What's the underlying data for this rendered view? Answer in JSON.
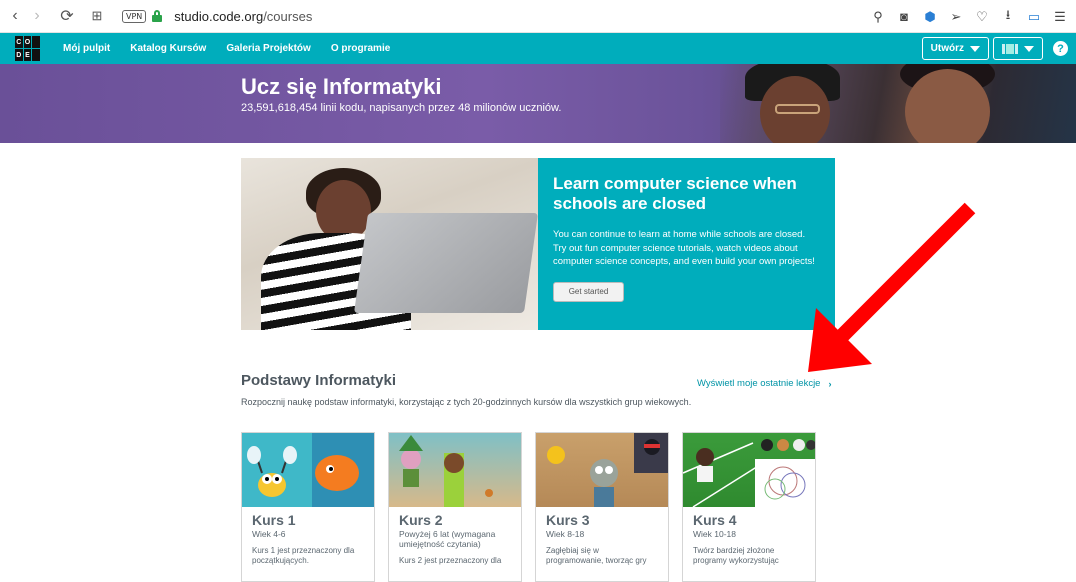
{
  "browser": {
    "vpn_label": "VPN",
    "url_domain": "studio.code.org",
    "url_path": "/courses"
  },
  "nav": {
    "logo_letters": [
      "C",
      "O",
      "D",
      "E"
    ],
    "links": [
      "Mój pulpit",
      "Katalog Kursów",
      "Galeria Projektów",
      "O programie"
    ],
    "create_label": "Utwórz",
    "help_label": "?"
  },
  "hero": {
    "title": "Ucz się Informatyki",
    "subtitle": "23,591,618,454 linii kodu, napisanych przez 48 milionów uczniów."
  },
  "promo": {
    "title": "Learn computer science when schools are closed",
    "body": "You can continue to learn at home while schools are closed. Try out fun computer science tutorials, watch videos about computer science concepts, and even build your own projects!",
    "button_label": "Get started"
  },
  "section": {
    "title": "Podstawy Informatyki",
    "link_label": "Wyświetl moje ostatnie lekcje",
    "description": "Rozpocznij naukę podstaw informatyki, korzystając z tych 20-godzinnych kursów dla wszystkich grup wiekowych."
  },
  "courses": [
    {
      "title": "Kurs 1",
      "age": "Wiek 4-6",
      "desc": "Kurs 1 jest przeznaczony dla początkujących."
    },
    {
      "title": "Kurs 2",
      "age": "Powyżej 6 lat (wymagana umiejętność czytania)",
      "desc": "Kurs 2 jest przeznaczony dla"
    },
    {
      "title": "Kurs 3",
      "age": "Wiek 8-18",
      "desc": "Zagłębiaj się w programowanie, tworząc gry"
    },
    {
      "title": "Kurs 4",
      "age": "Wiek 10-18",
      "desc": "Twórz bardziej złożone programy wykorzystując"
    }
  ],
  "colors": {
    "teal": "#00adbc",
    "hero_purple": "#6a5098",
    "annotation_arrow": "#ff0000"
  }
}
